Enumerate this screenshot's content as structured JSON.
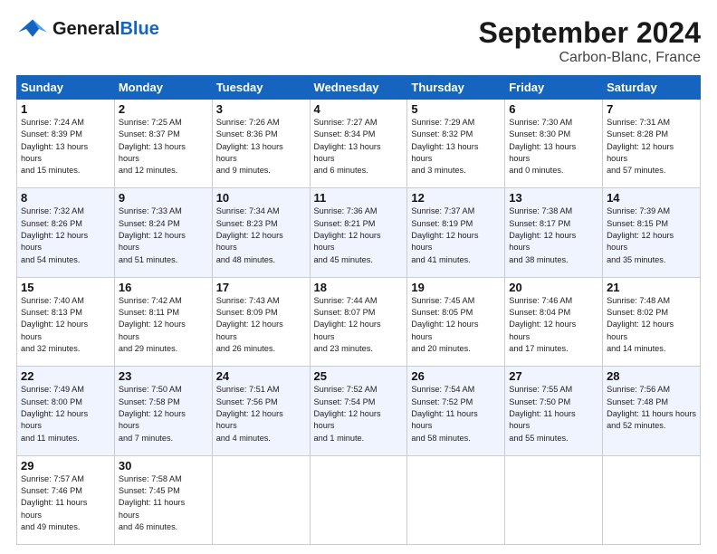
{
  "header": {
    "logo_line1": "General",
    "logo_line2": "Blue",
    "month": "September 2024",
    "location": "Carbon-Blanc, France"
  },
  "weekdays": [
    "Sunday",
    "Monday",
    "Tuesday",
    "Wednesday",
    "Thursday",
    "Friday",
    "Saturday"
  ],
  "weeks": [
    [
      {
        "day": "1",
        "sunrise": "7:24 AM",
        "sunset": "8:39 PM",
        "daylight": "13 hours and 15 minutes."
      },
      {
        "day": "2",
        "sunrise": "7:25 AM",
        "sunset": "8:37 PM",
        "daylight": "13 hours and 12 minutes."
      },
      {
        "day": "3",
        "sunrise": "7:26 AM",
        "sunset": "8:36 PM",
        "daylight": "13 hours and 9 minutes."
      },
      {
        "day": "4",
        "sunrise": "7:27 AM",
        "sunset": "8:34 PM",
        "daylight": "13 hours and 6 minutes."
      },
      {
        "day": "5",
        "sunrise": "7:29 AM",
        "sunset": "8:32 PM",
        "daylight": "13 hours and 3 minutes."
      },
      {
        "day": "6",
        "sunrise": "7:30 AM",
        "sunset": "8:30 PM",
        "daylight": "13 hours and 0 minutes."
      },
      {
        "day": "7",
        "sunrise": "7:31 AM",
        "sunset": "8:28 PM",
        "daylight": "12 hours and 57 minutes."
      }
    ],
    [
      {
        "day": "8",
        "sunrise": "7:32 AM",
        "sunset": "8:26 PM",
        "daylight": "12 hours and 54 minutes."
      },
      {
        "day": "9",
        "sunrise": "7:33 AM",
        "sunset": "8:24 PM",
        "daylight": "12 hours and 51 minutes."
      },
      {
        "day": "10",
        "sunrise": "7:34 AM",
        "sunset": "8:23 PM",
        "daylight": "12 hours and 48 minutes."
      },
      {
        "day": "11",
        "sunrise": "7:36 AM",
        "sunset": "8:21 PM",
        "daylight": "12 hours and 45 minutes."
      },
      {
        "day": "12",
        "sunrise": "7:37 AM",
        "sunset": "8:19 PM",
        "daylight": "12 hours and 41 minutes."
      },
      {
        "day": "13",
        "sunrise": "7:38 AM",
        "sunset": "8:17 PM",
        "daylight": "12 hours and 38 minutes."
      },
      {
        "day": "14",
        "sunrise": "7:39 AM",
        "sunset": "8:15 PM",
        "daylight": "12 hours and 35 minutes."
      }
    ],
    [
      {
        "day": "15",
        "sunrise": "7:40 AM",
        "sunset": "8:13 PM",
        "daylight": "12 hours and 32 minutes."
      },
      {
        "day": "16",
        "sunrise": "7:42 AM",
        "sunset": "8:11 PM",
        "daylight": "12 hours and 29 minutes."
      },
      {
        "day": "17",
        "sunrise": "7:43 AM",
        "sunset": "8:09 PM",
        "daylight": "12 hours and 26 minutes."
      },
      {
        "day": "18",
        "sunrise": "7:44 AM",
        "sunset": "8:07 PM",
        "daylight": "12 hours and 23 minutes."
      },
      {
        "day": "19",
        "sunrise": "7:45 AM",
        "sunset": "8:05 PM",
        "daylight": "12 hours and 20 minutes."
      },
      {
        "day": "20",
        "sunrise": "7:46 AM",
        "sunset": "8:04 PM",
        "daylight": "12 hours and 17 minutes."
      },
      {
        "day": "21",
        "sunrise": "7:48 AM",
        "sunset": "8:02 PM",
        "daylight": "12 hours and 14 minutes."
      }
    ],
    [
      {
        "day": "22",
        "sunrise": "7:49 AM",
        "sunset": "8:00 PM",
        "daylight": "12 hours and 11 minutes."
      },
      {
        "day": "23",
        "sunrise": "7:50 AM",
        "sunset": "7:58 PM",
        "daylight": "12 hours and 7 minutes."
      },
      {
        "day": "24",
        "sunrise": "7:51 AM",
        "sunset": "7:56 PM",
        "daylight": "12 hours and 4 minutes."
      },
      {
        "day": "25",
        "sunrise": "7:52 AM",
        "sunset": "7:54 PM",
        "daylight": "12 hours and 1 minute."
      },
      {
        "day": "26",
        "sunrise": "7:54 AM",
        "sunset": "7:52 PM",
        "daylight": "11 hours and 58 minutes."
      },
      {
        "day": "27",
        "sunrise": "7:55 AM",
        "sunset": "7:50 PM",
        "daylight": "11 hours and 55 minutes."
      },
      {
        "day": "28",
        "sunrise": "7:56 AM",
        "sunset": "7:48 PM",
        "daylight": "11 hours and 52 minutes."
      }
    ],
    [
      {
        "day": "29",
        "sunrise": "7:57 AM",
        "sunset": "7:46 PM",
        "daylight": "11 hours and 49 minutes."
      },
      {
        "day": "30",
        "sunrise": "7:58 AM",
        "sunset": "7:45 PM",
        "daylight": "11 hours and 46 minutes."
      },
      null,
      null,
      null,
      null,
      null
    ]
  ]
}
